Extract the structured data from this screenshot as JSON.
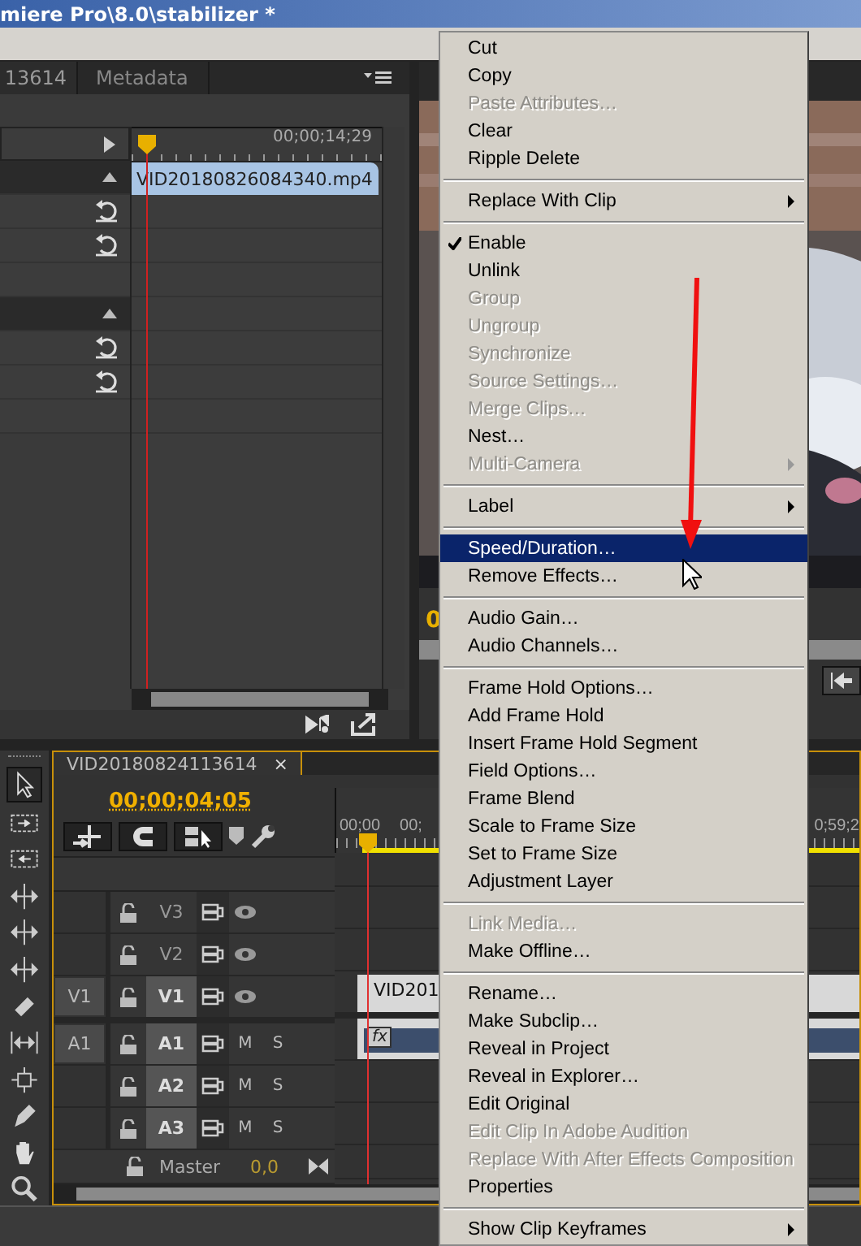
{
  "window": {
    "title": "miere Pro\\8.0\\stabilizer *"
  },
  "upper_panel": {
    "tabs": [
      {
        "label": "13614",
        "selected": true
      },
      {
        "label": "Metadata",
        "selected": false
      }
    ],
    "timecode": "00;00;14;29",
    "clip": "VID20180826084340.mp4",
    "rows": [
      {
        "kind": "expander"
      },
      {
        "kind": "section"
      },
      {
        "kind": "param"
      },
      {
        "kind": "param"
      },
      {
        "kind": "blank"
      },
      {
        "kind": "section"
      },
      {
        "kind": "param"
      },
      {
        "kind": "param"
      },
      {
        "kind": "blank"
      }
    ]
  },
  "program_monitor": {
    "timecode": "0"
  },
  "timeline": {
    "tab": "VID20180824113614",
    "close": "×",
    "timecode": "00;00;04;05",
    "ruler": [
      "00;00",
      "00;",
      "0;59;2"
    ],
    "tracks": [
      {
        "kind": "video",
        "name": "V3",
        "targeted": false
      },
      {
        "kind": "video",
        "name": "V2",
        "targeted": false
      },
      {
        "kind": "video",
        "name": "V1",
        "targeted": true,
        "source": "V1",
        "clip": "VID201"
      },
      {
        "kind": "audio",
        "name": "A1",
        "targeted": true,
        "source": "A1",
        "mute": "M",
        "solo": "S",
        "clip": "fx"
      },
      {
        "kind": "audio",
        "name": "A2",
        "targeted": true,
        "mute": "M",
        "solo": "S"
      },
      {
        "kind": "audio",
        "name": "A3",
        "targeted": true,
        "mute": "M",
        "solo": "S"
      }
    ],
    "master": {
      "name": "Master",
      "value": "0,0"
    }
  },
  "context_menu": {
    "groups": [
      [
        {
          "label": "Cut",
          "disabled": false,
          "checked": false,
          "submenu": false,
          "selected": false
        },
        {
          "label": "Copy",
          "disabled": false,
          "checked": false,
          "submenu": false,
          "selected": false
        },
        {
          "label": "Paste Attributes…",
          "disabled": true,
          "checked": false,
          "submenu": false,
          "selected": false
        },
        {
          "label": "Clear",
          "disabled": false,
          "checked": false,
          "submenu": false,
          "selected": false
        },
        {
          "label": "Ripple Delete",
          "disabled": false,
          "checked": false,
          "submenu": false,
          "selected": false
        }
      ],
      [
        {
          "label": "Replace With Clip",
          "disabled": false,
          "checked": false,
          "submenu": true,
          "selected": false
        }
      ],
      [
        {
          "label": "Enable",
          "disabled": false,
          "checked": true,
          "submenu": false,
          "selected": false
        },
        {
          "label": "Unlink",
          "disabled": false,
          "checked": false,
          "submenu": false,
          "selected": false
        },
        {
          "label": "Group",
          "disabled": true,
          "checked": false,
          "submenu": false,
          "selected": false
        },
        {
          "label": "Ungroup",
          "disabled": true,
          "checked": false,
          "submenu": false,
          "selected": false
        },
        {
          "label": "Synchronize",
          "disabled": true,
          "checked": false,
          "submenu": false,
          "selected": false
        },
        {
          "label": "Source Settings…",
          "disabled": true,
          "checked": false,
          "submenu": false,
          "selected": false
        },
        {
          "label": "Merge Clips…",
          "disabled": true,
          "checked": false,
          "submenu": false,
          "selected": false
        },
        {
          "label": "Nest…",
          "disabled": false,
          "checked": false,
          "submenu": false,
          "selected": false
        },
        {
          "label": "Multi-Camera",
          "disabled": true,
          "checked": false,
          "submenu": true,
          "selected": false
        }
      ],
      [
        {
          "label": "Label",
          "disabled": false,
          "checked": false,
          "submenu": true,
          "selected": false
        }
      ],
      [
        {
          "label": "Speed/Duration…",
          "disabled": false,
          "checked": false,
          "submenu": false,
          "selected": true
        },
        {
          "label": "Remove Effects…",
          "disabled": false,
          "checked": false,
          "submenu": false,
          "selected": false
        }
      ],
      [
        {
          "label": "Audio Gain…",
          "disabled": false,
          "checked": false,
          "submenu": false,
          "selected": false
        },
        {
          "label": "Audio Channels…",
          "disabled": false,
          "checked": false,
          "submenu": false,
          "selected": false
        }
      ],
      [
        {
          "label": "Frame Hold Options…",
          "disabled": false,
          "checked": false,
          "submenu": false,
          "selected": false
        },
        {
          "label": "Add Frame Hold",
          "disabled": false,
          "checked": false,
          "submenu": false,
          "selected": false
        },
        {
          "label": "Insert Frame Hold Segment",
          "disabled": false,
          "checked": false,
          "submenu": false,
          "selected": false
        },
        {
          "label": "Field Options…",
          "disabled": false,
          "checked": false,
          "submenu": false,
          "selected": false
        },
        {
          "label": "Frame Blend",
          "disabled": false,
          "checked": false,
          "submenu": false,
          "selected": false
        },
        {
          "label": "Scale to Frame Size",
          "disabled": false,
          "checked": false,
          "submenu": false,
          "selected": false
        },
        {
          "label": "Set to Frame Size",
          "disabled": false,
          "checked": false,
          "submenu": false,
          "selected": false
        },
        {
          "label": "Adjustment Layer",
          "disabled": false,
          "checked": false,
          "submenu": false,
          "selected": false
        }
      ],
      [
        {
          "label": "Link Media…",
          "disabled": true,
          "checked": false,
          "submenu": false,
          "selected": false
        },
        {
          "label": "Make Offline…",
          "disabled": false,
          "checked": false,
          "submenu": false,
          "selected": false
        }
      ],
      [
        {
          "label": "Rename…",
          "disabled": false,
          "checked": false,
          "submenu": false,
          "selected": false
        },
        {
          "label": "Make Subclip…",
          "disabled": false,
          "checked": false,
          "submenu": false,
          "selected": false
        },
        {
          "label": "Reveal in Project",
          "disabled": false,
          "checked": false,
          "submenu": false,
          "selected": false
        },
        {
          "label": "Reveal in Explorer…",
          "disabled": false,
          "checked": false,
          "submenu": false,
          "selected": false
        },
        {
          "label": "Edit Original",
          "disabled": false,
          "checked": false,
          "submenu": false,
          "selected": false
        },
        {
          "label": "Edit Clip In Adobe Audition",
          "disabled": true,
          "checked": false,
          "submenu": false,
          "selected": false
        },
        {
          "label": "Replace With After Effects Composition",
          "disabled": true,
          "checked": false,
          "submenu": false,
          "selected": false
        },
        {
          "label": "Properties",
          "disabled": false,
          "checked": false,
          "submenu": false,
          "selected": false
        }
      ],
      [
        {
          "label": "Show Clip Keyframes",
          "disabled": false,
          "checked": false,
          "submenu": true,
          "selected": false
        }
      ]
    ]
  }
}
